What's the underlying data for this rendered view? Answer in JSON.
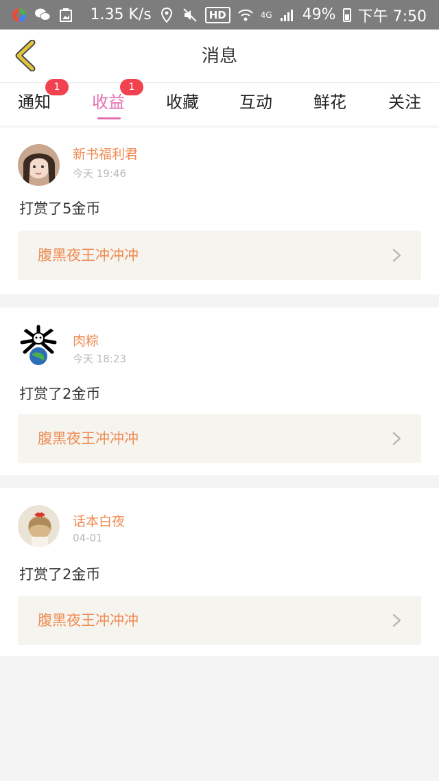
{
  "status_bar": {
    "network_speed": "1.35 K/s",
    "hd": "HD",
    "signal_type": "4G",
    "battery": "49%",
    "time": "下午 7:50",
    "icons": [
      "app-icon",
      "wechat-icon",
      "gallery-icon",
      "location-icon",
      "mute-icon",
      "wifi-icon",
      "signal-icon",
      "battery-icon"
    ]
  },
  "header": {
    "title": "消息",
    "back_icon": "chevron-left-icon",
    "accent": "#e3c53c"
  },
  "tabs": [
    {
      "label": "通知",
      "badge": "1",
      "active": false
    },
    {
      "label": "收益",
      "badge": "1",
      "active": true
    },
    {
      "label": "收藏",
      "badge": "",
      "active": false
    },
    {
      "label": "互动",
      "badge": "",
      "active": false
    },
    {
      "label": "鲜花",
      "badge": "",
      "active": false
    },
    {
      "label": "关注",
      "badge": "",
      "active": false
    }
  ],
  "messages": [
    {
      "user": "新书福利君",
      "time": "今天 19:46",
      "text": "打赏了5金币",
      "book": "腹黑夜王冲冲冲"
    },
    {
      "user": "肉粽",
      "time": "今天 18:23",
      "text": "打赏了2金币",
      "book": "腹黑夜王冲冲冲"
    },
    {
      "user": "话本白夜",
      "time": "04-01",
      "text": "打赏了2金币",
      "book": "腹黑夜王冲冲冲"
    }
  ],
  "colors": {
    "active_tab": "#e36fb0",
    "badge": "#f0424f",
    "name": "#f08a52",
    "book_bg": "#f5f4ef"
  }
}
